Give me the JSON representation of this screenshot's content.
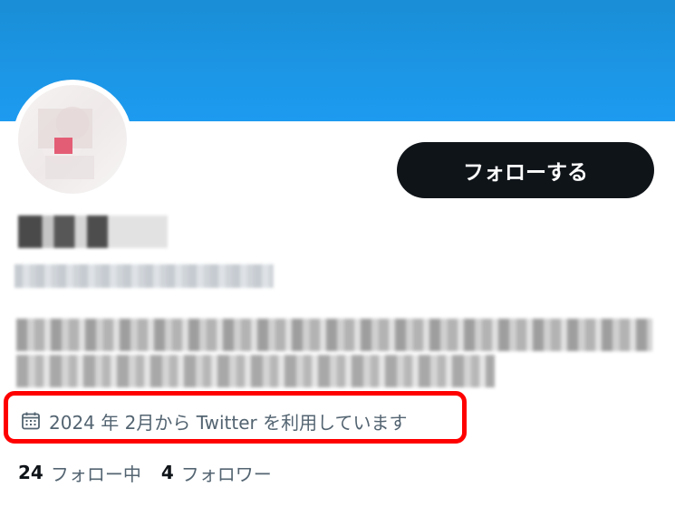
{
  "profile": {
    "follow_label": "フォローする",
    "joined_text": "2024 年 2月から Twitter を利用しています",
    "stats": {
      "following_count": "24",
      "following_label": "フォロー中",
      "followers_count": "4",
      "followers_label": "フォロワー"
    }
  },
  "icons": {
    "calendar": "calendar-icon"
  },
  "colors": {
    "banner": "#1d9bf0",
    "button_bg": "#0f1419",
    "highlight_border": "#ff0000",
    "secondary_text": "#536471"
  }
}
